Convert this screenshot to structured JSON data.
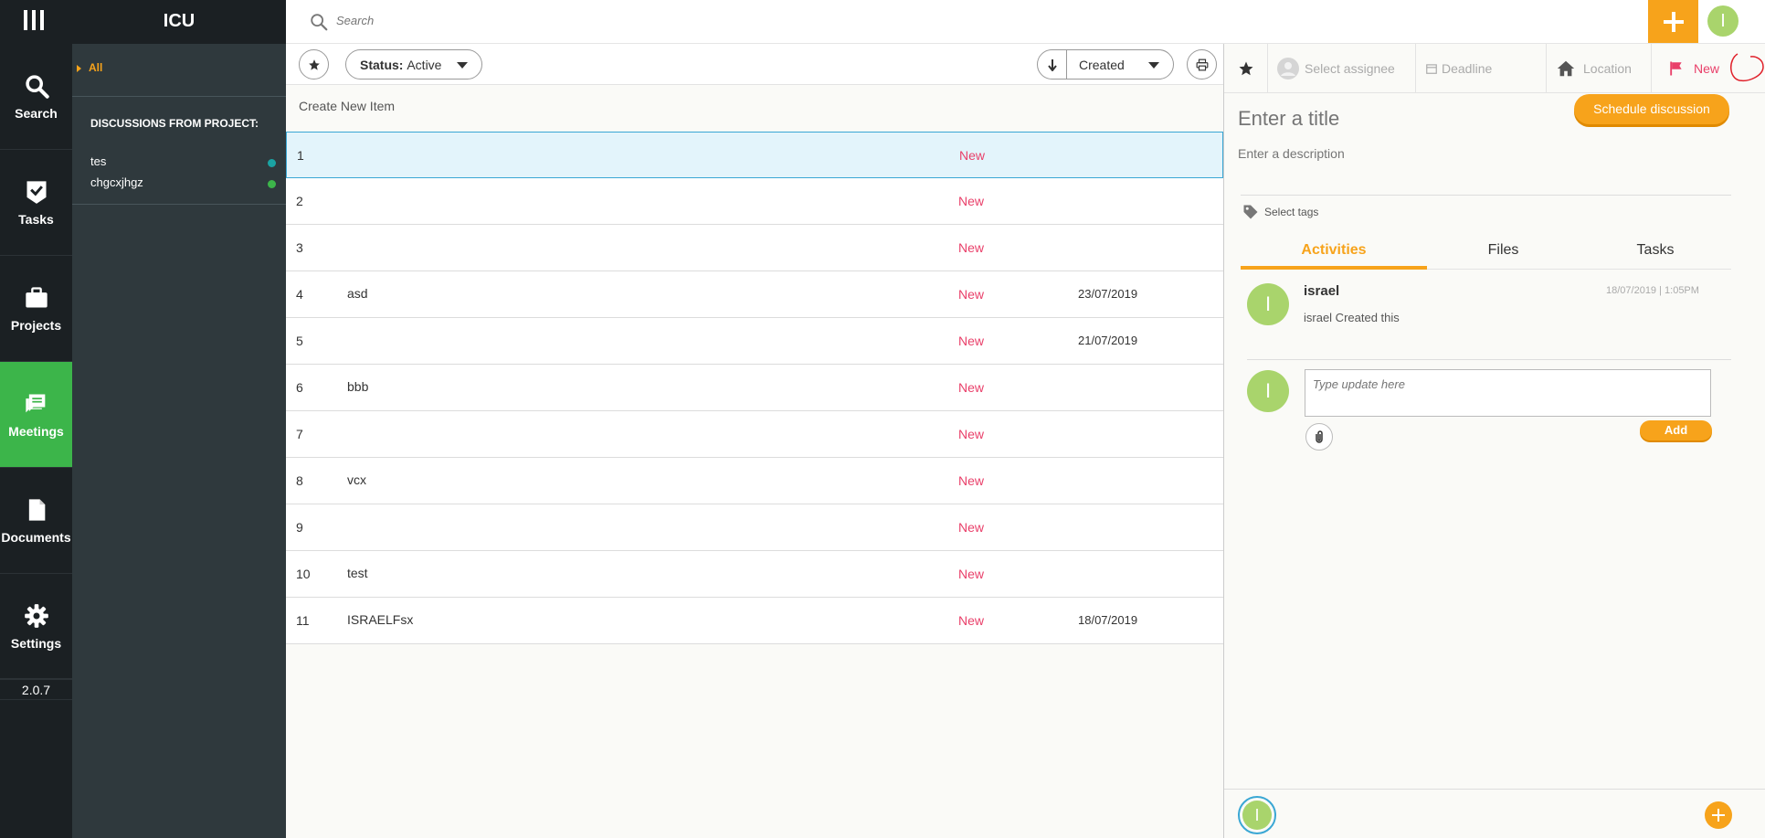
{
  "app": {
    "title": "ICU",
    "version": "2.0.7"
  },
  "nav": {
    "items": [
      {
        "label": "Search",
        "icon": "search-icon"
      },
      {
        "label": "Tasks",
        "icon": "task-check-icon"
      },
      {
        "label": "Projects",
        "icon": "briefcase-icon"
      },
      {
        "label": "Meetings",
        "icon": "chat-bubbles-icon",
        "active": true
      },
      {
        "label": "Documents",
        "icon": "document-icon"
      },
      {
        "label": "Settings",
        "icon": "gear-icon"
      }
    ]
  },
  "sidebar": {
    "filter_all": "All",
    "section_title": "DISCUSSIONS FROM PROJECT:",
    "projects": [
      {
        "name": "tes",
        "color": "#1aa3a3"
      },
      {
        "name": "chgcxjhgz",
        "color": "#3cb54a"
      }
    ]
  },
  "topbar": {
    "search_placeholder": "Search",
    "avatar_initial": "I"
  },
  "list": {
    "status_label": "Status:",
    "status_value": "Active",
    "sort_value": "Created",
    "create_new": "Create New Item",
    "rows": [
      {
        "num": "1",
        "title": "",
        "status": "New",
        "date": ""
      },
      {
        "num": "2",
        "title": "",
        "status": "New",
        "date": ""
      },
      {
        "num": "3",
        "title": "",
        "status": "New",
        "date": ""
      },
      {
        "num": "4",
        "title": "asd",
        "status": "New",
        "date": "23/07/2019"
      },
      {
        "num": "5",
        "title": "",
        "status": "New",
        "date": "21/07/2019"
      },
      {
        "num": "6",
        "title": "bbb",
        "status": "New",
        "date": ""
      },
      {
        "num": "7",
        "title": "",
        "status": "New",
        "date": ""
      },
      {
        "num": "8",
        "title": "vcx",
        "status": "New",
        "date": ""
      },
      {
        "num": "9",
        "title": "",
        "status": "New",
        "date": ""
      },
      {
        "num": "10",
        "title": "test",
        "status": "New",
        "date": ""
      },
      {
        "num": "11",
        "title": "ISRAELFsx",
        "status": "New",
        "date": "18/07/2019"
      }
    ]
  },
  "detail": {
    "assignee_placeholder": "Select assignee",
    "deadline_label": "Deadline",
    "location_label": "Location",
    "status_label": "New",
    "title_placeholder": "Enter a title",
    "description_placeholder": "Enter a description",
    "schedule_button": "Schedule discussion",
    "tags_placeholder": "Select tags",
    "tabs": [
      "Activities",
      "Files",
      "Tasks"
    ],
    "activity": {
      "user": "israel",
      "time": "18/07/2019 | 1:05PM",
      "text": "israel Created this",
      "avatar_initial": "I"
    },
    "update_placeholder": "Type update here",
    "add_button": "Add",
    "footer_avatar_initial": "I"
  },
  "colors": {
    "accent": "#f7a31b",
    "active_nav": "#3cb54a",
    "status_new": "#e9406a",
    "selected_row": "#e3f4fb"
  }
}
